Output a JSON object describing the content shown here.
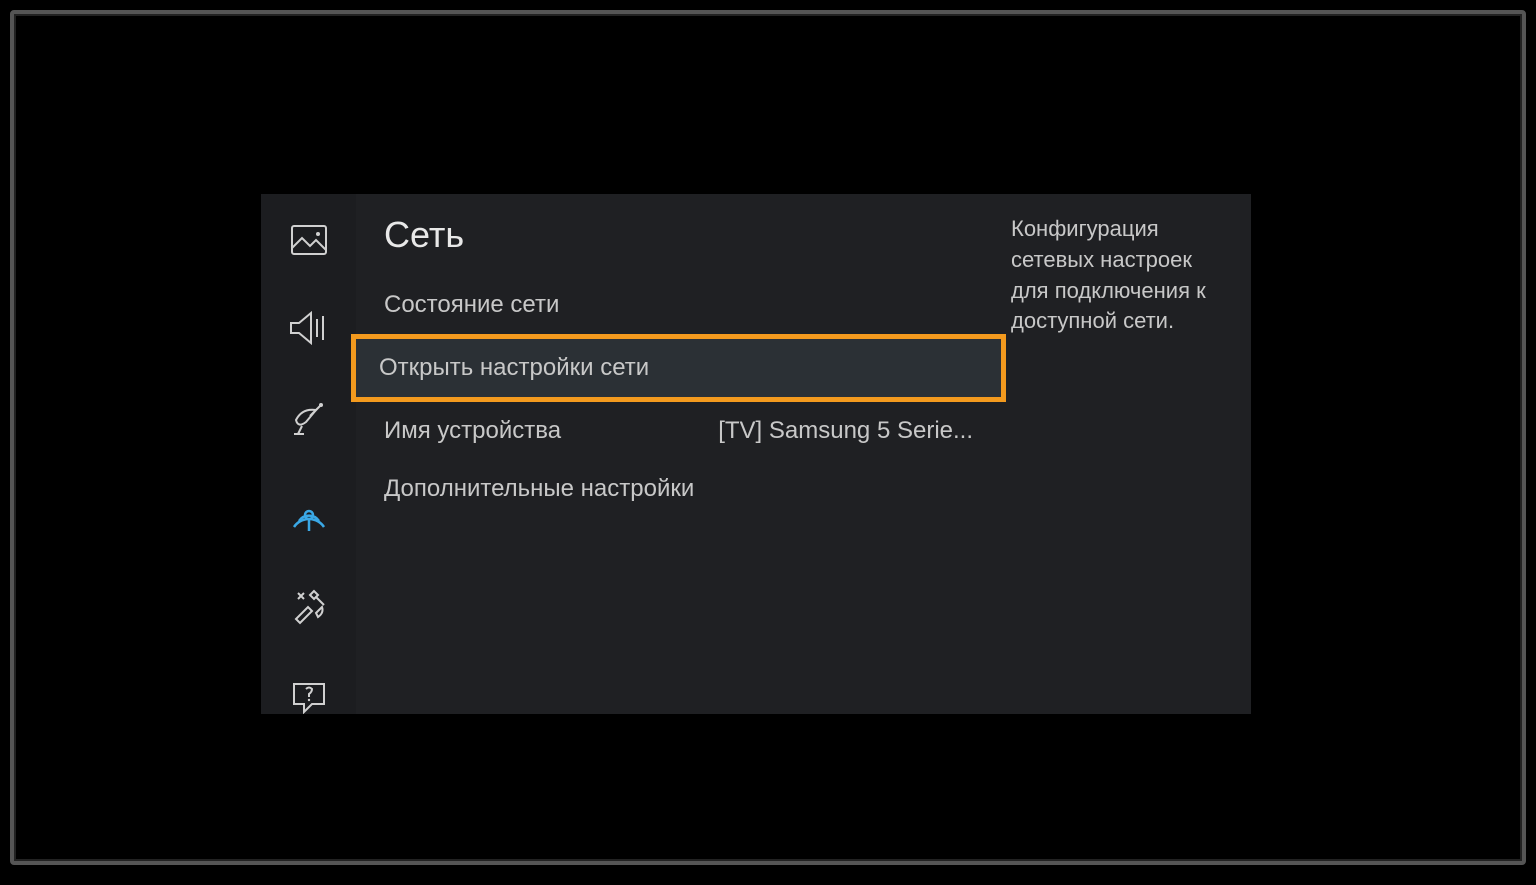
{
  "colors": {
    "highlight_border": "#f39a1e",
    "active_icon": "#3aa8e6",
    "panel_bg": "#1f2023"
  },
  "sidebar": {
    "items": [
      {
        "icon": "picture-icon",
        "active": false
      },
      {
        "icon": "sound-icon",
        "active": false
      },
      {
        "icon": "broadcast-icon",
        "active": false
      },
      {
        "icon": "network-icon",
        "active": true
      },
      {
        "icon": "system-icon",
        "active": false
      },
      {
        "icon": "support-icon",
        "active": false
      }
    ]
  },
  "main": {
    "title": "Сеть",
    "items": [
      {
        "label": "Состояние сети",
        "value": "",
        "highlighted": false
      },
      {
        "label": "Открыть настройки сети",
        "value": "",
        "highlighted": true
      },
      {
        "label": "Имя устройства",
        "value": "[TV] Samsung 5 Serie...",
        "highlighted": false
      },
      {
        "label": "Дополнительные настройки",
        "value": "",
        "highlighted": false
      }
    ]
  },
  "description": "Конфигурация сетевых настроек для подключения к доступной сети."
}
